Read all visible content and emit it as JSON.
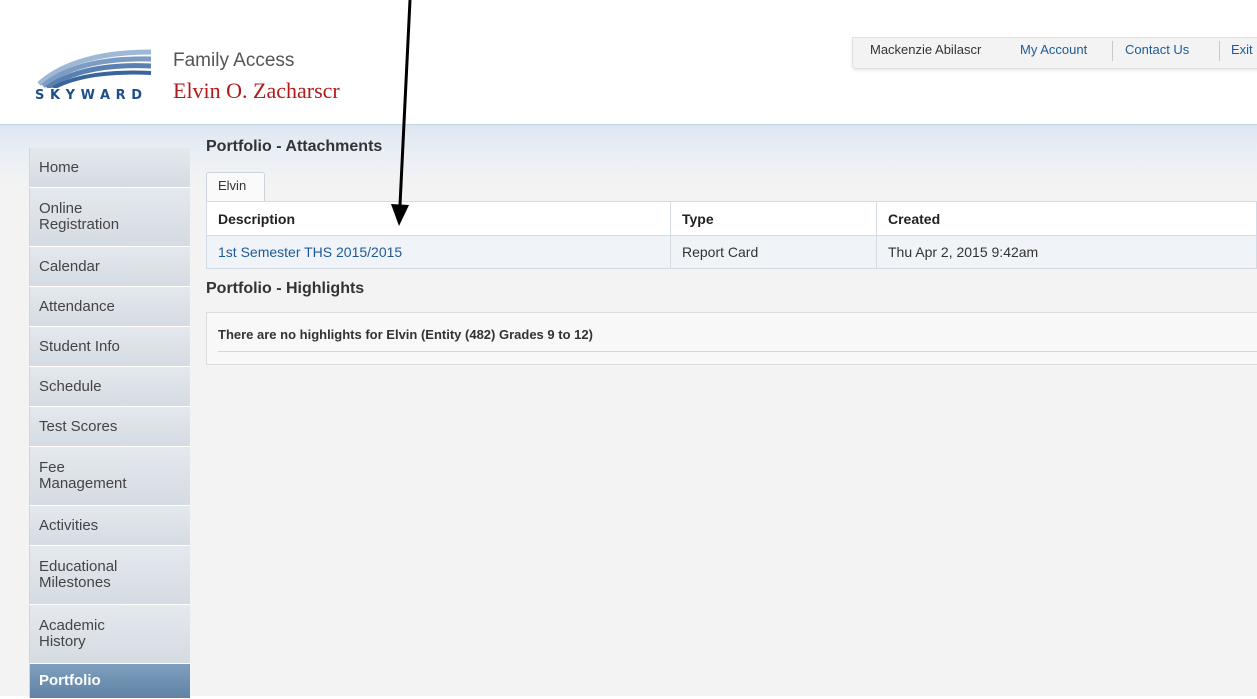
{
  "header": {
    "logo_text": "SKYWARD",
    "app_name": "Family Access",
    "student_name": "Elvin O. Zacharscr"
  },
  "topnav": {
    "user_name": "Mackenzie Abilascr",
    "my_account": "My Account",
    "contact_us": "Contact Us",
    "exit": "Exit"
  },
  "sidebar": {
    "items": [
      {
        "label": "Home"
      },
      {
        "label": "Online Registration"
      },
      {
        "label": "Calendar"
      },
      {
        "label": "Attendance"
      },
      {
        "label": "Student Info"
      },
      {
        "label": "Schedule"
      },
      {
        "label": "Test Scores"
      },
      {
        "label": "Fee Management"
      },
      {
        "label": "Activities"
      },
      {
        "label": "Educational Milestones"
      },
      {
        "label": "Academic History"
      },
      {
        "label": "Portfolio"
      }
    ],
    "active": "Portfolio"
  },
  "attachments": {
    "title": "Portfolio - Attachments",
    "tab": "Elvin",
    "columns": [
      "Description",
      "Type",
      "Created"
    ],
    "rows": [
      {
        "description": "1st Semester THS 2015/2015",
        "type": "Report Card",
        "created": "Thu Apr 2, 2015 9:42am"
      }
    ]
  },
  "highlights": {
    "title": "Portfolio - Highlights",
    "message": "There are no highlights for Elvin (Entity (482) Grades 9 to 12)"
  },
  "colors": {
    "brand_blue": "#1e4f88",
    "student_name_red": "#b01a1a",
    "link_blue": "#1d5a9a",
    "sidebar_active": "#6b8db0"
  }
}
